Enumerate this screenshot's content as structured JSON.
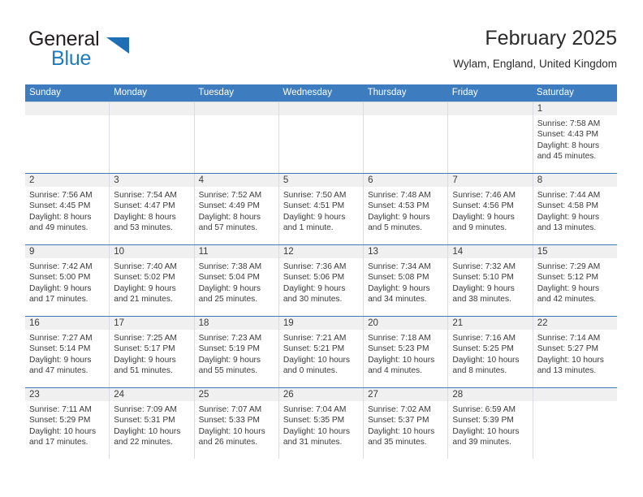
{
  "brand": {
    "name_part1": "General",
    "name_part2": "Blue",
    "triangle_color": "#1f6fb5",
    "blue_text_color": "#1f7bc1"
  },
  "header": {
    "title": "February 2025",
    "subtitle": "Wylam, England, United Kingdom",
    "accent_color": "#3c7cbf"
  },
  "weekdays": [
    "Sunday",
    "Monday",
    "Tuesday",
    "Wednesday",
    "Thursday",
    "Friday",
    "Saturday"
  ],
  "weeks": [
    [
      {
        "day": "",
        "sunrise": "",
        "sunset": "",
        "daylight1": "",
        "daylight2": "",
        "empty": true
      },
      {
        "day": "",
        "sunrise": "",
        "sunset": "",
        "daylight1": "",
        "daylight2": "",
        "empty": true
      },
      {
        "day": "",
        "sunrise": "",
        "sunset": "",
        "daylight1": "",
        "daylight2": "",
        "empty": true
      },
      {
        "day": "",
        "sunrise": "",
        "sunset": "",
        "daylight1": "",
        "daylight2": "",
        "empty": true
      },
      {
        "day": "",
        "sunrise": "",
        "sunset": "",
        "daylight1": "",
        "daylight2": "",
        "empty": true
      },
      {
        "day": "",
        "sunrise": "",
        "sunset": "",
        "daylight1": "",
        "daylight2": "",
        "empty": true
      },
      {
        "day": "1",
        "sunrise": "Sunrise: 7:58 AM",
        "sunset": "Sunset: 4:43 PM",
        "daylight1": "Daylight: 8 hours",
        "daylight2": "and 45 minutes.",
        "empty": false
      }
    ],
    [
      {
        "day": "2",
        "sunrise": "Sunrise: 7:56 AM",
        "sunset": "Sunset: 4:45 PM",
        "daylight1": "Daylight: 8 hours",
        "daylight2": "and 49 minutes.",
        "empty": false
      },
      {
        "day": "3",
        "sunrise": "Sunrise: 7:54 AM",
        "sunset": "Sunset: 4:47 PM",
        "daylight1": "Daylight: 8 hours",
        "daylight2": "and 53 minutes.",
        "empty": false
      },
      {
        "day": "4",
        "sunrise": "Sunrise: 7:52 AM",
        "sunset": "Sunset: 4:49 PM",
        "daylight1": "Daylight: 8 hours",
        "daylight2": "and 57 minutes.",
        "empty": false
      },
      {
        "day": "5",
        "sunrise": "Sunrise: 7:50 AM",
        "sunset": "Sunset: 4:51 PM",
        "daylight1": "Daylight: 9 hours",
        "daylight2": "and 1 minute.",
        "empty": false
      },
      {
        "day": "6",
        "sunrise": "Sunrise: 7:48 AM",
        "sunset": "Sunset: 4:53 PM",
        "daylight1": "Daylight: 9 hours",
        "daylight2": "and 5 minutes.",
        "empty": false
      },
      {
        "day": "7",
        "sunrise": "Sunrise: 7:46 AM",
        "sunset": "Sunset: 4:56 PM",
        "daylight1": "Daylight: 9 hours",
        "daylight2": "and 9 minutes.",
        "empty": false
      },
      {
        "day": "8",
        "sunrise": "Sunrise: 7:44 AM",
        "sunset": "Sunset: 4:58 PM",
        "daylight1": "Daylight: 9 hours",
        "daylight2": "and 13 minutes.",
        "empty": false
      }
    ],
    [
      {
        "day": "9",
        "sunrise": "Sunrise: 7:42 AM",
        "sunset": "Sunset: 5:00 PM",
        "daylight1": "Daylight: 9 hours",
        "daylight2": "and 17 minutes.",
        "empty": false
      },
      {
        "day": "10",
        "sunrise": "Sunrise: 7:40 AM",
        "sunset": "Sunset: 5:02 PM",
        "daylight1": "Daylight: 9 hours",
        "daylight2": "and 21 minutes.",
        "empty": false
      },
      {
        "day": "11",
        "sunrise": "Sunrise: 7:38 AM",
        "sunset": "Sunset: 5:04 PM",
        "daylight1": "Daylight: 9 hours",
        "daylight2": "and 25 minutes.",
        "empty": false
      },
      {
        "day": "12",
        "sunrise": "Sunrise: 7:36 AM",
        "sunset": "Sunset: 5:06 PM",
        "daylight1": "Daylight: 9 hours",
        "daylight2": "and 30 minutes.",
        "empty": false
      },
      {
        "day": "13",
        "sunrise": "Sunrise: 7:34 AM",
        "sunset": "Sunset: 5:08 PM",
        "daylight1": "Daylight: 9 hours",
        "daylight2": "and 34 minutes.",
        "empty": false
      },
      {
        "day": "14",
        "sunrise": "Sunrise: 7:32 AM",
        "sunset": "Sunset: 5:10 PM",
        "daylight1": "Daylight: 9 hours",
        "daylight2": "and 38 minutes.",
        "empty": false
      },
      {
        "day": "15",
        "sunrise": "Sunrise: 7:29 AM",
        "sunset": "Sunset: 5:12 PM",
        "daylight1": "Daylight: 9 hours",
        "daylight2": "and 42 minutes.",
        "empty": false
      }
    ],
    [
      {
        "day": "16",
        "sunrise": "Sunrise: 7:27 AM",
        "sunset": "Sunset: 5:14 PM",
        "daylight1": "Daylight: 9 hours",
        "daylight2": "and 47 minutes.",
        "empty": false
      },
      {
        "day": "17",
        "sunrise": "Sunrise: 7:25 AM",
        "sunset": "Sunset: 5:17 PM",
        "daylight1": "Daylight: 9 hours",
        "daylight2": "and 51 minutes.",
        "empty": false
      },
      {
        "day": "18",
        "sunrise": "Sunrise: 7:23 AM",
        "sunset": "Sunset: 5:19 PM",
        "daylight1": "Daylight: 9 hours",
        "daylight2": "and 55 minutes.",
        "empty": false
      },
      {
        "day": "19",
        "sunrise": "Sunrise: 7:21 AM",
        "sunset": "Sunset: 5:21 PM",
        "daylight1": "Daylight: 10 hours",
        "daylight2": "and 0 minutes.",
        "empty": false
      },
      {
        "day": "20",
        "sunrise": "Sunrise: 7:18 AM",
        "sunset": "Sunset: 5:23 PM",
        "daylight1": "Daylight: 10 hours",
        "daylight2": "and 4 minutes.",
        "empty": false
      },
      {
        "day": "21",
        "sunrise": "Sunrise: 7:16 AM",
        "sunset": "Sunset: 5:25 PM",
        "daylight1": "Daylight: 10 hours",
        "daylight2": "and 8 minutes.",
        "empty": false
      },
      {
        "day": "22",
        "sunrise": "Sunrise: 7:14 AM",
        "sunset": "Sunset: 5:27 PM",
        "daylight1": "Daylight: 10 hours",
        "daylight2": "and 13 minutes.",
        "empty": false
      }
    ],
    [
      {
        "day": "23",
        "sunrise": "Sunrise: 7:11 AM",
        "sunset": "Sunset: 5:29 PM",
        "daylight1": "Daylight: 10 hours",
        "daylight2": "and 17 minutes.",
        "empty": false
      },
      {
        "day": "24",
        "sunrise": "Sunrise: 7:09 AM",
        "sunset": "Sunset: 5:31 PM",
        "daylight1": "Daylight: 10 hours",
        "daylight2": "and 22 minutes.",
        "empty": false
      },
      {
        "day": "25",
        "sunrise": "Sunrise: 7:07 AM",
        "sunset": "Sunset: 5:33 PM",
        "daylight1": "Daylight: 10 hours",
        "daylight2": "and 26 minutes.",
        "empty": false
      },
      {
        "day": "26",
        "sunrise": "Sunrise: 7:04 AM",
        "sunset": "Sunset: 5:35 PM",
        "daylight1": "Daylight: 10 hours",
        "daylight2": "and 31 minutes.",
        "empty": false
      },
      {
        "day": "27",
        "sunrise": "Sunrise: 7:02 AM",
        "sunset": "Sunset: 5:37 PM",
        "daylight1": "Daylight: 10 hours",
        "daylight2": "and 35 minutes.",
        "empty": false
      },
      {
        "day": "28",
        "sunrise": "Sunrise: 6:59 AM",
        "sunset": "Sunset: 5:39 PM",
        "daylight1": "Daylight: 10 hours",
        "daylight2": "and 39 minutes.",
        "empty": false
      },
      {
        "day": "",
        "sunrise": "",
        "sunset": "",
        "daylight1": "",
        "daylight2": "",
        "empty": true
      }
    ]
  ]
}
